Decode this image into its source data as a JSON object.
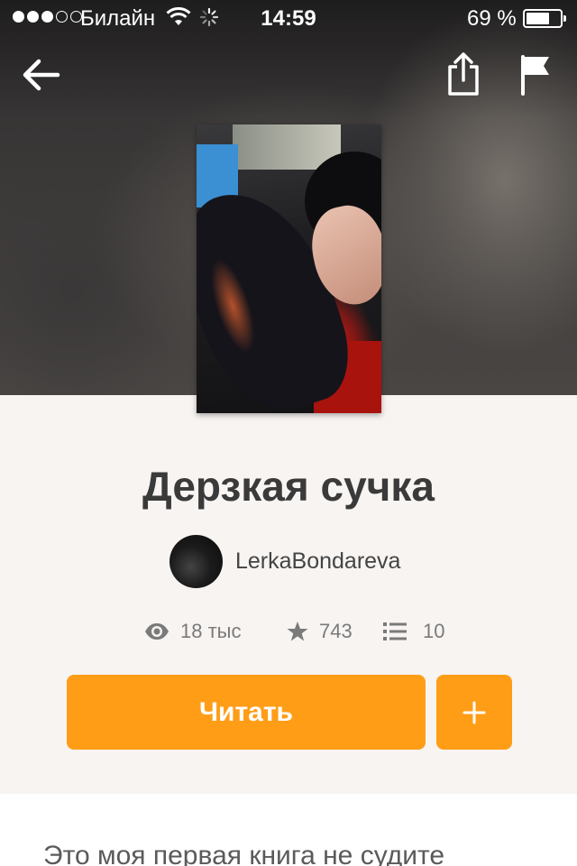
{
  "status_bar": {
    "carrier": "Билайн",
    "time": "14:59",
    "battery_percent_label": "69 %",
    "battery_level": 0.69,
    "signal_bars_filled": 3,
    "signal_bars_total": 5
  },
  "nav": {
    "icons": [
      "back-arrow-icon",
      "share-icon",
      "flag-icon"
    ]
  },
  "story": {
    "title": "Дерзкая сучка",
    "author": "LerkaBondareva",
    "stats": {
      "views": "18 тыс",
      "votes": "743",
      "parts": "10"
    },
    "read_label": "Читать",
    "add_label": "+",
    "description": "Это моя первая книга не судите"
  },
  "colors": {
    "accent": "#ff9d17",
    "background": "#f7f4f2"
  }
}
